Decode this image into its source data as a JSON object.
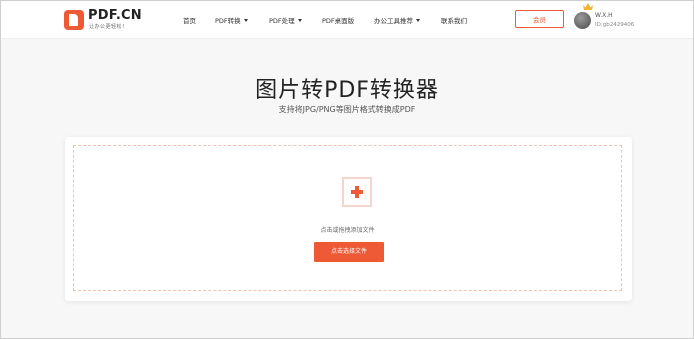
{
  "brand": {
    "name": "PDF.CN",
    "tagline": "让办公更轻松！",
    "accent_color": "#ee5a35"
  },
  "nav": {
    "items": [
      {
        "label": "首页",
        "has_dropdown": false
      },
      {
        "label": "PDF转换",
        "has_dropdown": true
      },
      {
        "label": "PDF处理",
        "has_dropdown": true
      },
      {
        "label": "PDF桌面版",
        "has_dropdown": false
      },
      {
        "label": "办公工具推荐",
        "has_dropdown": true
      },
      {
        "label": "联系我们",
        "has_dropdown": false
      }
    ]
  },
  "header": {
    "vip_label": "会员",
    "user_name": "W.X.H",
    "user_id": "ID:gb2429406"
  },
  "hero": {
    "title": "图片转PDF转换器",
    "subtitle": "支持将JPG/PNG等图片格式转换成PDF"
  },
  "upload": {
    "hint": "点击或拖拽添加文件",
    "button_label": "点击选择文件"
  }
}
